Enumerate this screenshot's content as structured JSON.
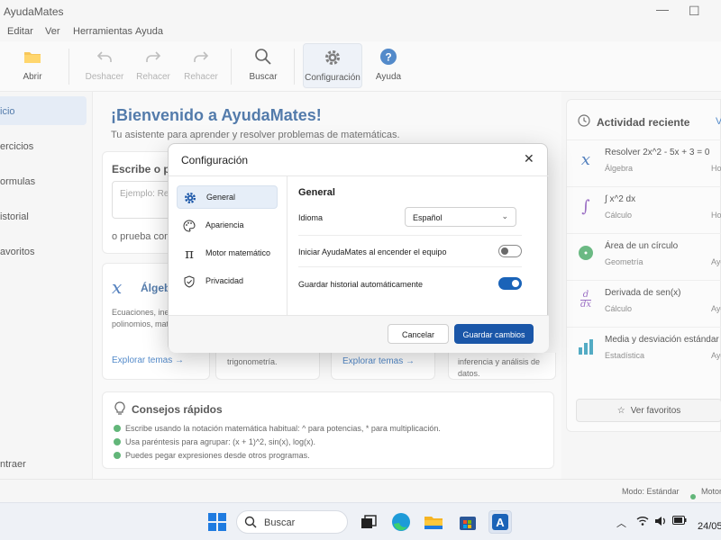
{
  "window": {
    "title": "AyudaMates"
  },
  "menu": [
    "Editar",
    "Ver",
    "Herramientas",
    "Ayuda"
  ],
  "toolbar": {
    "open": "Abrir",
    "undo": "Deshacer",
    "redo1": "Rehacer",
    "redo2": "Rehacer",
    "search": "Buscar",
    "settings": "Configuración",
    "help": "Ayuda"
  },
  "sidebar": {
    "items": [
      "icio",
      "ercicios",
      "ormulas",
      "istorial",
      "avoritos"
    ],
    "bottom": "ntraer"
  },
  "main": {
    "welcome": "¡Bienvenido a AyudaMates!",
    "subtitle": "Tu asistente para aprender y resolver problemas de matemáticas.",
    "prompt_title": "Escribe o pe",
    "prompt_placeholder": "Ejemplo: Res",
    "try": "o prueba con:",
    "algebra_title": "Álgebr",
    "algebra_desc": "Ecuaciones, inecu\npolinomios, matric",
    "explore1": "Explorar temas →",
    "card2_desc": "trigonometría.",
    "explore2": "Explorar temas →",
    "card4_desc": "inferencia y análisis de datos.",
    "tips_title": "Consejos rápidos",
    "tips": [
      "Escribe usando la notación matemática habitual: ^ para potencias, * para multiplicación.",
      "Usa paréntesis para agrupar: (x + 1)^2, sin(x), log(x).",
      "Puedes pegar expresiones desde otros programas."
    ]
  },
  "recent": {
    "title": "Actividad reciente",
    "link": "V",
    "items": [
      {
        "title": "Resolver 2x^2 - 5x + 3 = 0",
        "category": "Álgebra",
        "meta": "Ho"
      },
      {
        "title": "∫ x^2 dx",
        "category": "Cálculo",
        "meta": "Ho"
      },
      {
        "title": "Área de un círculo",
        "category": "Geometría",
        "meta": "Aye"
      },
      {
        "title": "Derivada de sen(x)",
        "category": "Cálculo",
        "meta": "Aye"
      },
      {
        "title": "Media y desviación estándar",
        "category": "Estadística",
        "meta": "Aye"
      }
    ],
    "fav_button": "Ver favoritos"
  },
  "status": {
    "mode": "Modo: Estándar",
    "motor": "Motor"
  },
  "dialog": {
    "title": "Configuración",
    "nav": [
      "General",
      "Apariencia",
      "Motor matemático",
      "Privacidad"
    ],
    "section": "General",
    "language_label": "Idioma",
    "language_value": "Español",
    "startup_label": "Iniciar AyudaMates al encender el equipo",
    "history_label": "Guardar historial automáticamente",
    "startup_on": false,
    "history_on": true,
    "cancel": "Cancelar",
    "save": "Guardar cambios"
  },
  "taskbar": {
    "search": "Buscar",
    "clock": "24/05"
  },
  "colors": {
    "accent": "#1a56a8",
    "title": "#1a4f8f",
    "check": "#2e9e4d"
  }
}
